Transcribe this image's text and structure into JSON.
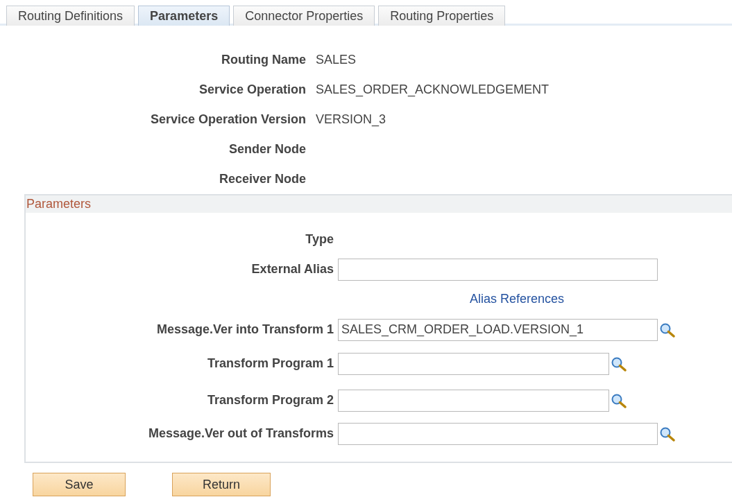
{
  "tabs": [
    {
      "label": "Routing Definitions",
      "selected": false
    },
    {
      "label": "Parameters",
      "selected": true
    },
    {
      "label": "Connector Properties",
      "selected": false
    },
    {
      "label": "Routing Properties",
      "selected": false
    }
  ],
  "info": [
    {
      "label": "Routing Name",
      "value": "SALES"
    },
    {
      "label": "Service Operation",
      "value": "SALES_ORDER_ACKNOWLEDGEMENT"
    },
    {
      "label": "Service Operation Version",
      "value": "VERSION_3"
    },
    {
      "label": "Sender Node"
    },
    {
      "label": "Receiver Node"
    }
  ],
  "parameters": {
    "title": "Parameters",
    "rows": [
      {
        "kind": "text",
        "label": "Type"
      },
      {
        "kind": "field",
        "label": "External Alias",
        "lookup": false
      },
      {
        "kind": "link",
        "label": "Alias References"
      },
      {
        "kind": "field",
        "label": "Message.Ver into Transform 1",
        "value": "SALES_CRM_ORDER_LOAD.VERSION_1",
        "lookup": true
      },
      {
        "kind": "short-field",
        "label": "Transform Program 1",
        "lookup": true
      },
      {
        "kind": "short-field",
        "label": "Transform Program 2",
        "lookup": true
      },
      {
        "kind": "field",
        "label": "Message.Ver out of Transforms",
        "lookup": true
      }
    ]
  },
  "buttons": [
    "Save",
    "Return"
  ]
}
